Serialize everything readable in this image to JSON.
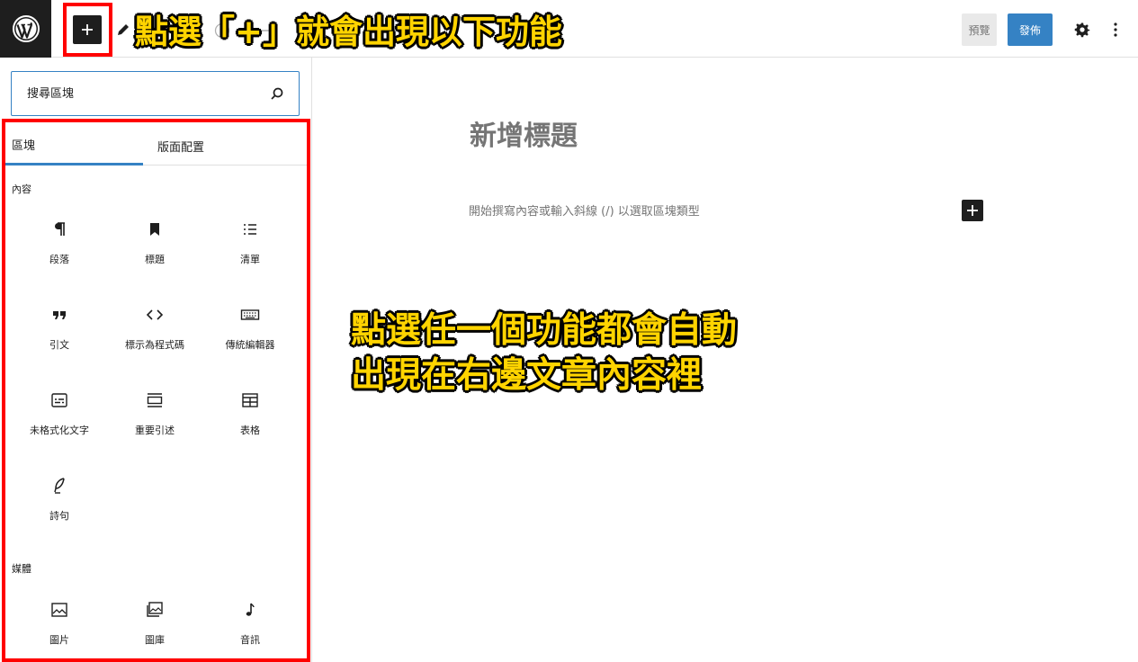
{
  "toolbar": {
    "preview_label": "預覽",
    "publish_label": "發佈"
  },
  "annotations": {
    "top": "點選「+」就會出現以下功能",
    "middle_line1": "點選任一個功能都會自動",
    "middle_line2": "出現在右邊文章內容裡"
  },
  "sidebar": {
    "search_placeholder": "搜尋區塊",
    "tabs": [
      {
        "label": "區塊"
      },
      {
        "label": "版面配置"
      }
    ],
    "categories": [
      {
        "label": "內容",
        "blocks": [
          {
            "label": "段落",
            "icon": "paragraph-icon"
          },
          {
            "label": "標題",
            "icon": "heading-icon"
          },
          {
            "label": "清單",
            "icon": "list-icon"
          },
          {
            "label": "引文",
            "icon": "quote-icon"
          },
          {
            "label": "標示為程式碼",
            "icon": "code-icon"
          },
          {
            "label": "傳統編輯器",
            "icon": "keyboard-icon"
          },
          {
            "label": "未格式化文字",
            "icon": "preformatted-icon"
          },
          {
            "label": "重要引述",
            "icon": "pullquote-icon"
          },
          {
            "label": "表格",
            "icon": "table-icon"
          },
          {
            "label": "詩句",
            "icon": "verse-icon"
          }
        ]
      },
      {
        "label": "媒體",
        "blocks": [
          {
            "label": "圖片",
            "icon": "image-icon"
          },
          {
            "label": "圖庫",
            "icon": "gallery-icon"
          },
          {
            "label": "音訊",
            "icon": "audio-icon"
          }
        ]
      }
    ]
  },
  "editor": {
    "title_placeholder": "新增標題",
    "body_placeholder": "開始撰寫內容或輸入斜線 (/) 以選取區塊類型"
  },
  "colors": {
    "accent": "#3582c4",
    "annotation_fill": "#ffd400",
    "annotation_box": "#ff0000",
    "dark": "#1e1e1e"
  }
}
